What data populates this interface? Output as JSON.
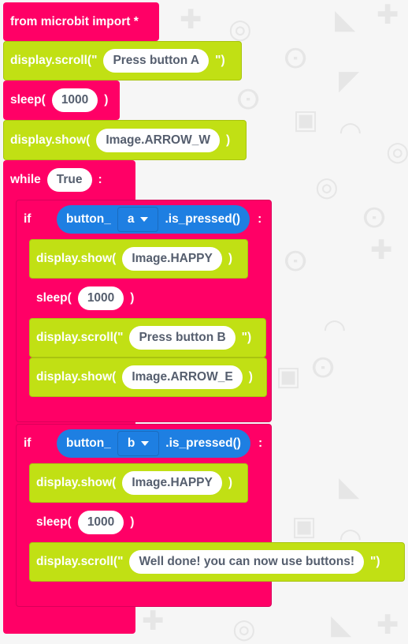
{
  "colors": {
    "control_block": "#ff0066",
    "display_block": "#c1e014",
    "logic_block": "#1e7fe2",
    "pill_bg": "#ffffff",
    "pill_text": "#555e6e",
    "workspace_bg": "#f6f6f6"
  },
  "background_icons": [
    "python-logo-icon",
    "puzzle-icon",
    "target-icon",
    "triangle-icon",
    "chip-icon",
    "grid-icon",
    "arc-icon"
  ],
  "blocks": {
    "import": {
      "label": "from microbit import *"
    },
    "scroll1": {
      "prefix": "display.scroll(\"",
      "value": "Press button A",
      "suffix": "\")"
    },
    "sleep1": {
      "prefix": "sleep(",
      "value": "1000",
      "suffix": ")"
    },
    "show1": {
      "prefix": "display.show(",
      "value": "Image.ARROW_W",
      "suffix": ")"
    },
    "while": {
      "keyword": "while",
      "value": "True",
      "suffix": ":"
    },
    "if_a": {
      "keyword": "if",
      "cond_prefix": "button_",
      "button_option": "a",
      "cond_suffix": ".is_pressed()",
      "suffix": ":",
      "body": {
        "show": {
          "prefix": "display.show(",
          "value": "Image.HAPPY",
          "suffix": ")"
        },
        "sleep": {
          "prefix": "sleep(",
          "value": "1000",
          "suffix": ")"
        },
        "scroll": {
          "prefix": "display.scroll(\"",
          "value": "Press button B",
          "suffix": "\")"
        },
        "show2": {
          "prefix": "display.show(",
          "value": "Image.ARROW_E",
          "suffix": ")"
        }
      }
    },
    "if_b": {
      "keyword": "if",
      "cond_prefix": "button_",
      "button_option": "b",
      "cond_suffix": ".is_pressed()",
      "suffix": ":",
      "body": {
        "show": {
          "prefix": "display.show(",
          "value": "Image.HAPPY",
          "suffix": ")"
        },
        "sleep": {
          "prefix": "sleep(",
          "value": "1000",
          "suffix": ")"
        },
        "scroll": {
          "prefix": "display.scroll(\"",
          "value": "Well done! you can now use buttons!",
          "suffix": "\")"
        }
      }
    }
  }
}
